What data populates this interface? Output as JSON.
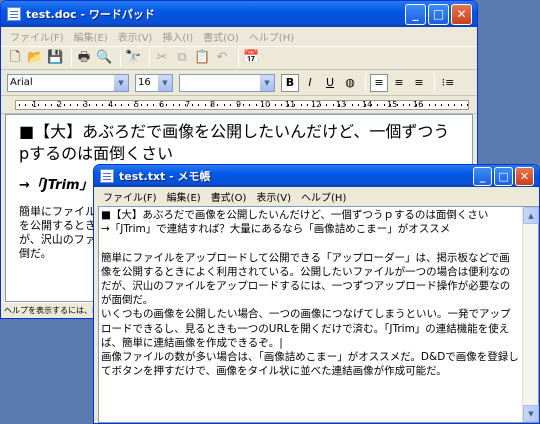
{
  "wordpad": {
    "title": "test.doc - ワードパッド",
    "menu": [
      "ファイル(F)",
      "編集(E)",
      "表示(V)",
      "挿入(I)",
      "書式(O)",
      "ヘルプ(H)"
    ],
    "font_name": "Arial",
    "font_size": "16",
    "script": "",
    "ruler_numbers": [
      "1",
      "2",
      "3",
      "4",
      "5",
      "6",
      "7",
      "8",
      "9",
      "10",
      "11",
      "12",
      "13",
      "14",
      "15",
      "16"
    ],
    "document": {
      "heading": "■【大】あぶろだで画像を公開したいんだけど、一個ずつうpするのは面倒くさい",
      "subheading": "→「JTrim」で連結すれば？大量にあるなら「画像詰めこまー」がオススメ",
      "body": "簡単にファイルをアップロードして公開できる「アップローダー」は、掲示板などで画像を公開するときによく利用されている。公開したいファイルが一つの場合は便利なのだが、沢山のファイルをアップロードするには、一つずつアップロード操作が必要なのが面倒だ。"
    },
    "status": "ヘルプを表示するには、F1 を押してください"
  },
  "notepad": {
    "title": "test.txt - メモ帳",
    "menu": [
      "ファイル(F)",
      "編集(E)",
      "書式(O)",
      "表示(V)",
      "ヘルプ(H)"
    ],
    "text": "■【大】あぶろだで画像を公開したいんだけど、一個ずつうｐするのは面倒くさい\n→「JTrim」で連結すれば？大量にあるなら「画像詰めこまー」がオススメ\n\n簡単にファイルをアップロードして公開できる「アップローダー」は、掲示板などで画像を公開するときによく利用されている。公開したいファイルが一つの場合は便利なのだが、沢山のファイルをアップロードするには、一つずつアップロード操作が必要なのが面倒だ。\nいくつもの画像を公開したい場合、一つの画像につなげてしまうといい。一発でアップロードできるし、見るときも一つのURLを開くだけで済む。「JTrim」の連結機能を使えば、簡単に連結画像を作成できるぞ。|\n画像ファイルの数が多い場合は、「画像詰めこまー」がオススメだ。D&Dで画像を登録してボタンを押すだけで、画像をタイル状に並べた連結画像が作成可能だ。"
  },
  "colors": {
    "titlebar": "#0058e6",
    "close_button": "#c8401b",
    "window_face": "#ece9d8",
    "desktop": "#5a7ab0"
  }
}
